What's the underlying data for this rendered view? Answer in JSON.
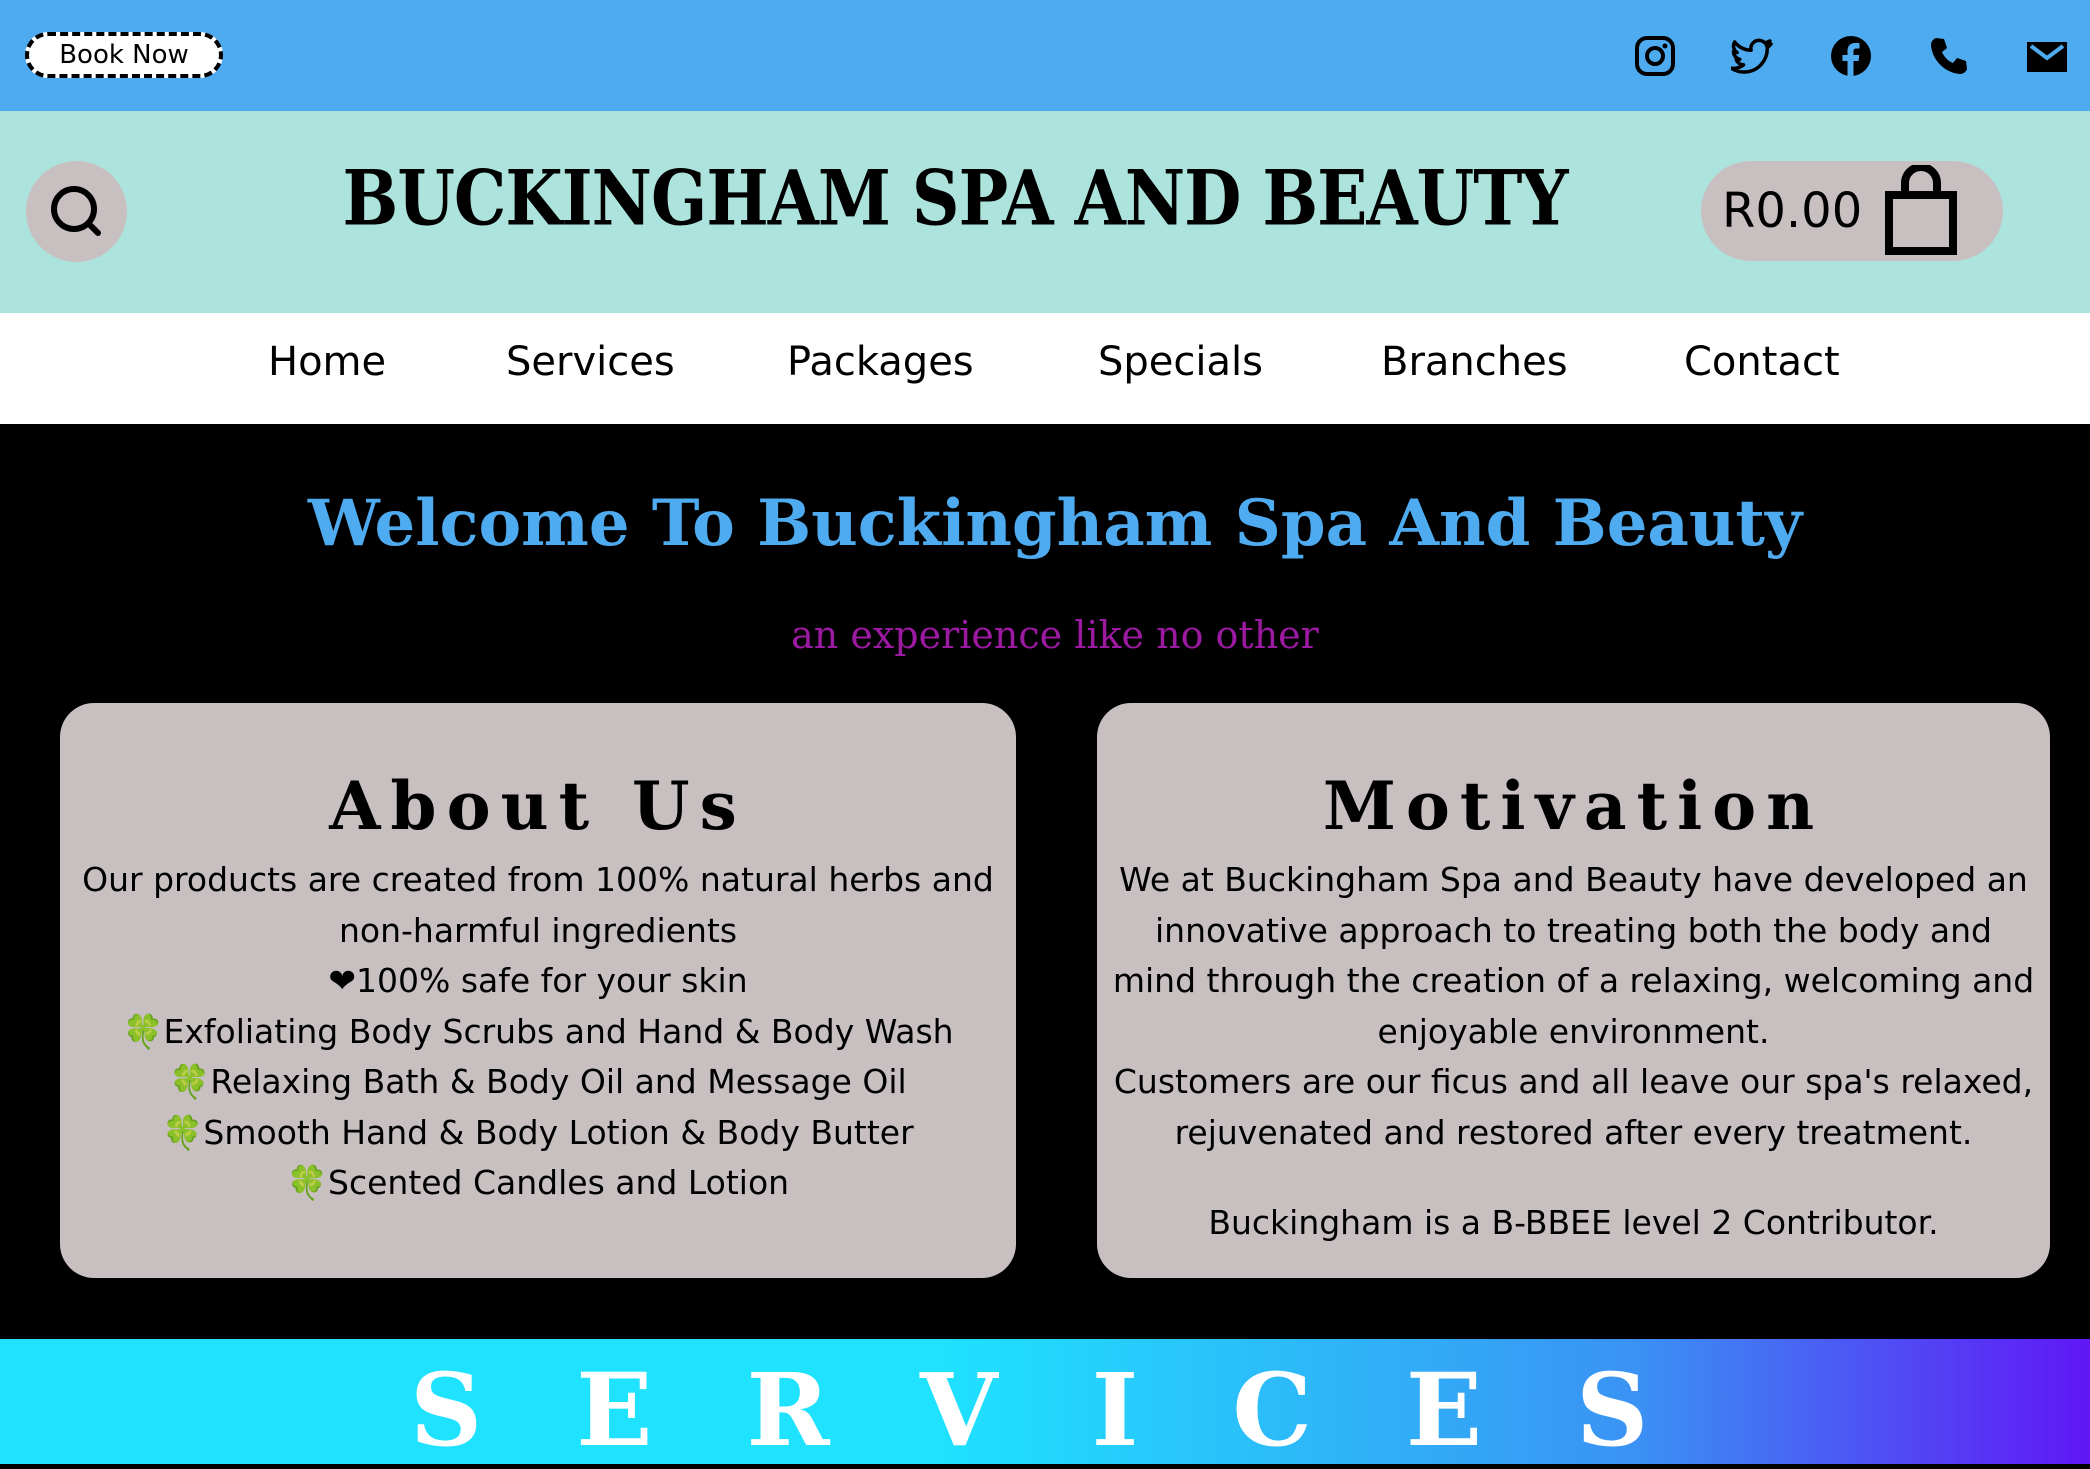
{
  "topbar": {
    "book_label": "Book Now",
    "social_icons": [
      "instagram-icon",
      "twitter-icon",
      "facebook-icon",
      "phone-icon",
      "email-icon"
    ]
  },
  "header": {
    "site_title": "BUCKINGHAM SPA AND BEAUTY",
    "cart_total": "R0.00"
  },
  "nav": {
    "items": [
      "Home",
      "Services",
      "Packages",
      "Specials",
      "Branches",
      "Contact"
    ]
  },
  "hero": {
    "welcome": "Welcome To Buckingham Spa And Beauty",
    "tagline": "an experience like no other"
  },
  "about": {
    "title": "About Us",
    "lines": [
      "Our products are created from 100% natural herbs and",
      "non-harmful ingredients",
      "❤100% safe for your skin",
      "🍀Exfoliating Body Scrubs and Hand & Body Wash",
      "🍀Relaxing Bath & Body Oil and Message Oil",
      "🍀Smooth Hand & Body Lotion & Body Butter",
      "🍀Scented Candles and Lotion"
    ]
  },
  "motivation": {
    "title": "Motivation",
    "lines": [
      "We at Buckingham Spa and Beauty have developed an",
      "innovative approach to treating both the body and",
      "mind through the creation of a relaxing, welcoming and",
      "enjoyable environment.",
      "Customers are our ficus and all leave our spa's relaxed,",
      "rejuvenated and restored after every treatment.",
      "",
      "Buckingham is a B-BBEE level 2 Contributor."
    ]
  },
  "services": {
    "title": "SERVICES"
  },
  "colors": {
    "topbar": "#4eabf0",
    "header": "#ace3dc",
    "card": "#c8c0c0",
    "welcome": "#4eabf0",
    "tagline": "#9c1aa1"
  }
}
